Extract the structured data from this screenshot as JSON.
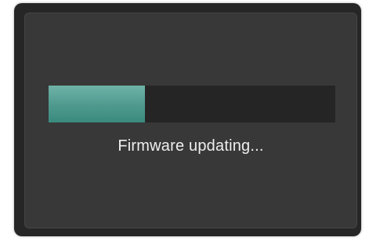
{
  "dialog": {
    "status_text": "Firmware updating...",
    "progress_fraction": 0.335
  },
  "colors": {
    "frame": "#262626",
    "screen": "#383838",
    "track": "#252525",
    "fill_accent": "#4e998d",
    "text": "#eeeeee"
  }
}
